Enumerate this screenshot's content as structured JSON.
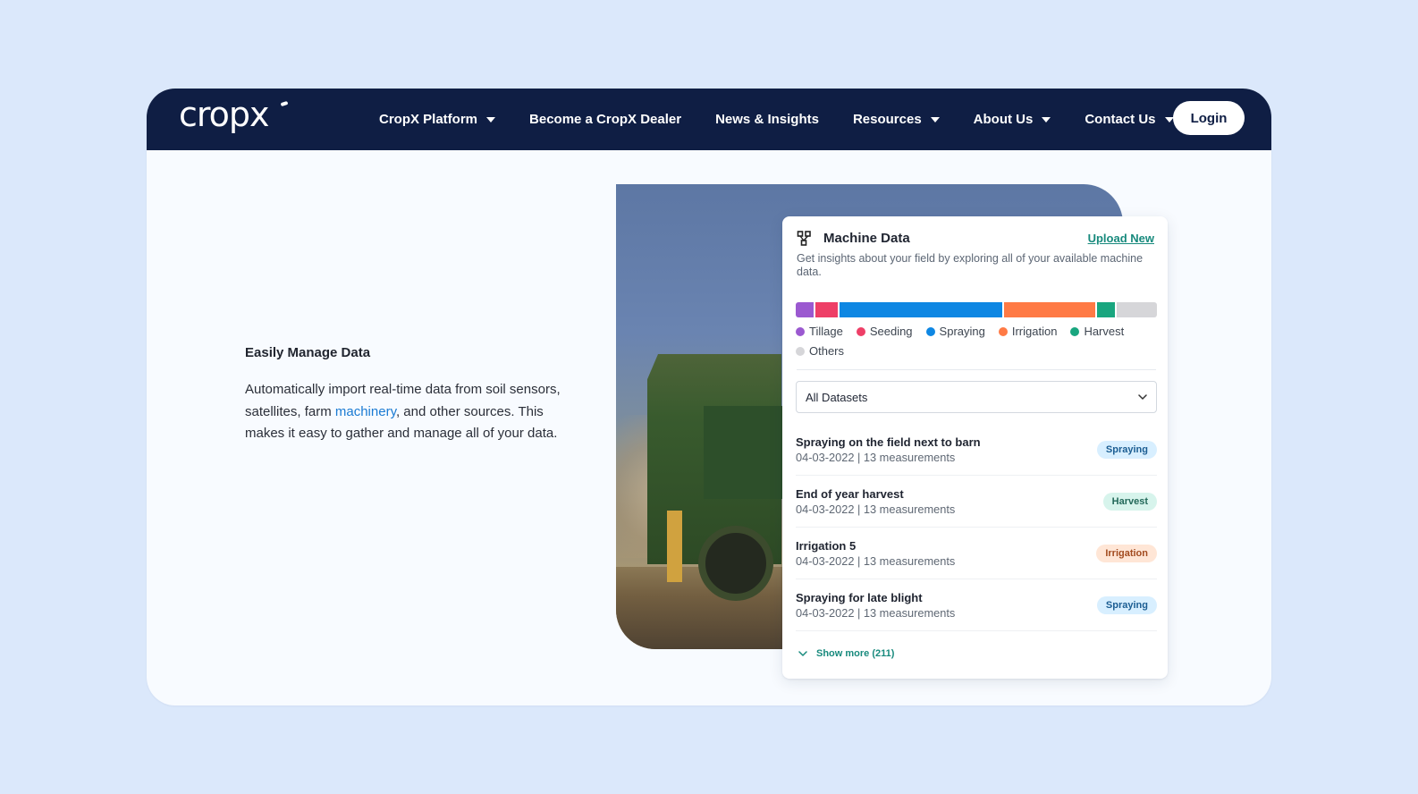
{
  "nav": {
    "logo": "cropx",
    "items": [
      {
        "label": "CropX Platform",
        "has_caret": true
      },
      {
        "label": "Become a CropX Dealer",
        "has_caret": false
      },
      {
        "label": "News & Insights",
        "has_caret": false
      },
      {
        "label": "Resources",
        "has_caret": true
      },
      {
        "label": "About Us",
        "has_caret": true
      },
      {
        "label": "Contact Us",
        "has_caret": true
      }
    ],
    "login": "Login"
  },
  "hero": {
    "title": "Easily Manage Data",
    "body_before": "Automatically import real-time data from soil sensors, satellites, farm ",
    "body_link": "machinery",
    "body_after": ", and other sources. This makes it easy to gather and manage all of your data."
  },
  "panel": {
    "title": "Machine Data",
    "upload_label": "Upload New",
    "description": "Get insights about your field by exploring all of your available machine data.",
    "distribution": [
      {
        "label": "Tillage",
        "color": "#9b59d0",
        "share": 5
      },
      {
        "label": "Seeding",
        "color": "#ee3f67",
        "share": 6
      },
      {
        "label": "Spraying",
        "color": "#0e87e3",
        "share": 45
      },
      {
        "label": "Irrigation",
        "color": "#ff7a45",
        "share": 25
      },
      {
        "label": "Harvest",
        "color": "#19a67f",
        "share": 5
      },
      {
        "label": "Others",
        "color": "#d6d6d9",
        "share": 11
      }
    ],
    "dataset_select": "All Datasets",
    "entries": [
      {
        "title": "Spraying on the field next to barn",
        "meta": "04-03-2022 | 13 measurements",
        "badge": "Spraying",
        "type": "spraying"
      },
      {
        "title": "End of year harvest",
        "meta": "04-03-2022 | 13 measurements",
        "badge": "Harvest",
        "type": "harvest"
      },
      {
        "title": "Irrigation 5",
        "meta": "04-03-2022 | 13 measurements",
        "badge": "Irrigation",
        "type": "irrigation"
      },
      {
        "title": "Spraying for late blight",
        "meta": "04-03-2022 | 13 measurements",
        "badge": "Spraying",
        "type": "spraying"
      }
    ],
    "show_more": "Show more (211)"
  }
}
